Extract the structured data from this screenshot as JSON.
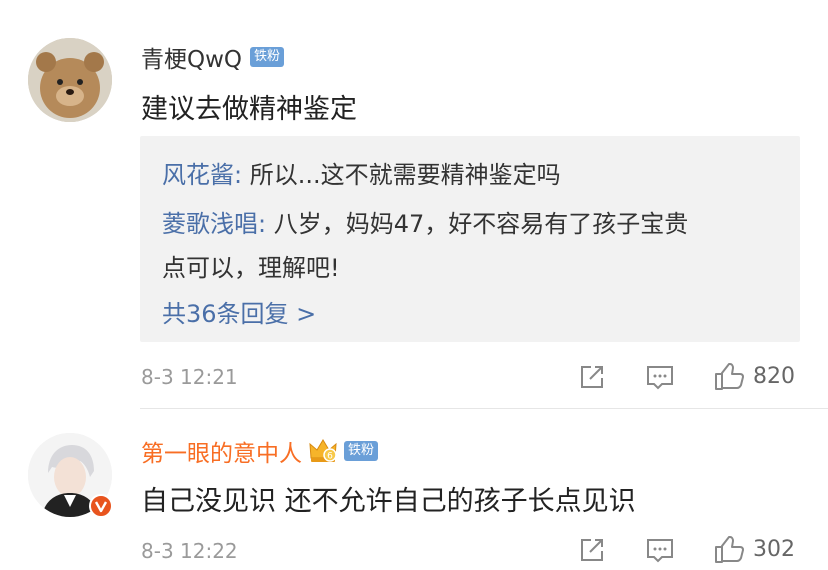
{
  "comments": [
    {
      "username": "青梗QwQ",
      "badge": "铁粉",
      "content": "建议去做精神鉴定",
      "replies": [
        {
          "name": "风花酱:",
          "text": " 所以...这不就需要精神鉴定吗"
        },
        {
          "name": "菱歌浅唱:",
          "text": " 八岁，妈妈47，好不容易有了孩子宝贵",
          "text_cont": "点可以，理解吧!"
        }
      ],
      "more_replies": "共36条回复 >",
      "time": "8-3 12:21",
      "likes": "820",
      "icons": [
        "share-icon",
        "comment-icon",
        "like-icon"
      ]
    },
    {
      "username": "第一眼的意中人",
      "badge": "铁粉",
      "content": "自己没见识 还不允许自己的孩子长点见识",
      "time": "8-3 12:22",
      "likes": "302",
      "icons": [
        "share-icon",
        "comment-icon",
        "like-icon"
      ]
    }
  ],
  "colors": {
    "reply_name": "#4a6fa8",
    "vip_name": "#f86e24",
    "badge_bg": "#6a9fd8",
    "verified": "#e8541e"
  }
}
